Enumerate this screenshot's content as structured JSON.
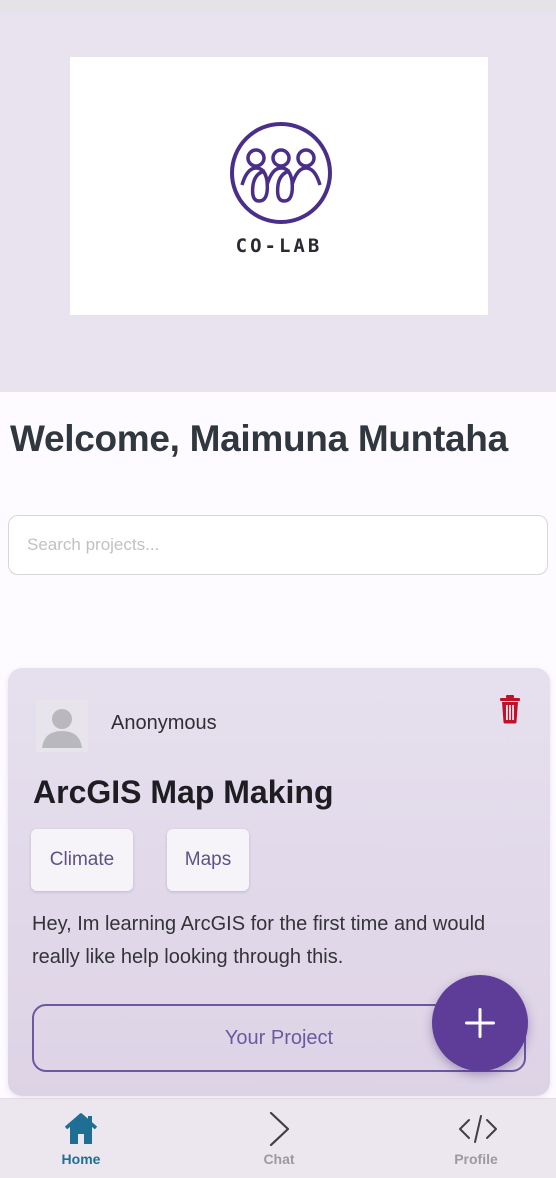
{
  "brand": {
    "logo_text": "CO-LAB"
  },
  "welcome": {
    "text": "Welcome, Maimuna Muntaha"
  },
  "search": {
    "placeholder": "Search projects..."
  },
  "project_card": {
    "author": "Anonymous",
    "title": "ArcGIS Map Making",
    "tags": [
      "Climate",
      "Maps"
    ],
    "description": "Hey, Im learning ArcGIS for the first time and would really like help looking through this.",
    "action_label": "Your Project"
  },
  "bottom_nav": {
    "items": [
      {
        "label": "Home",
        "icon": "home-icon",
        "active": true
      },
      {
        "label": "Chat",
        "icon": "chevron-right-icon",
        "active": false
      },
      {
        "label": "Profile",
        "icon": "code-icon",
        "active": false
      }
    ]
  },
  "colors": {
    "accent": "#5d3d98",
    "hero_background": "#e9e3ef",
    "card_background": "#e2daea",
    "active_nav": "#1f6f95",
    "delete": "#c0102a"
  }
}
